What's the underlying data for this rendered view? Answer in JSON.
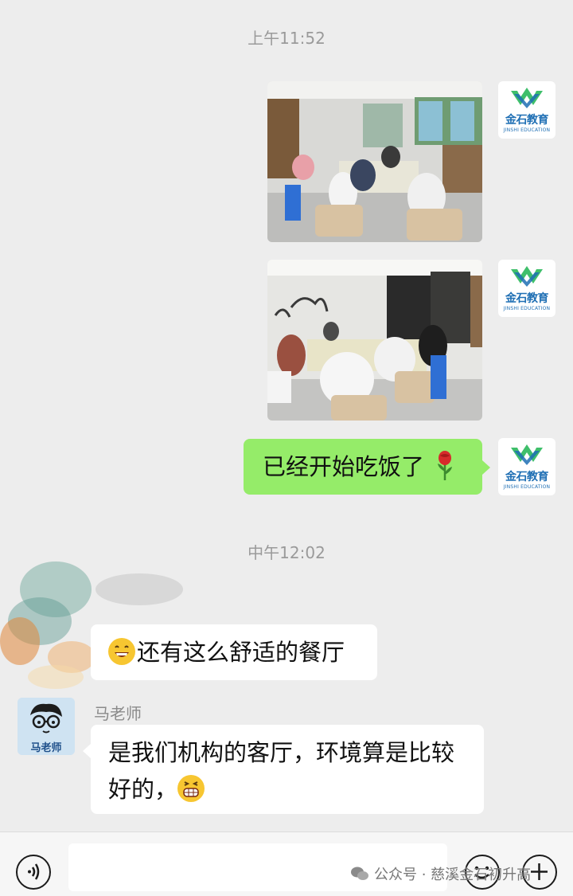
{
  "timestamps": [
    "上午11:52",
    "中午12:02"
  ],
  "self_avatar": {
    "brand": "金石教育",
    "brand_sub": "JINSHI EDUCATION",
    "colors": {
      "blue": "#1f6fb4",
      "green": "#3fbf6b"
    }
  },
  "messages": {
    "photo_1": {
      "desc_icon": "photo-dining-room"
    },
    "photo_2": {
      "desc_icon": "photo-dining-room"
    },
    "outgoing_text": "已经开始吃饭了",
    "outgoing_emoji": "rose-icon",
    "incoming_1": "还有这么舒适的餐厅",
    "incoming_1_emoji": "grinning-face-icon",
    "sender_name": "马老师",
    "teacher_avatar_label": "马老师",
    "incoming_2_line1": "是我们机构的客厅，环境算是比较",
    "incoming_2_line2": "好的，",
    "incoming_2_emoji": "grinning-teeth-face-icon"
  },
  "input_bar": {
    "voice_icon": "voice-icon",
    "emoji_icon": "emoji-icon",
    "plus_icon": "plus-icon",
    "watermark": "公众号 · 慈溪金石初升高"
  }
}
